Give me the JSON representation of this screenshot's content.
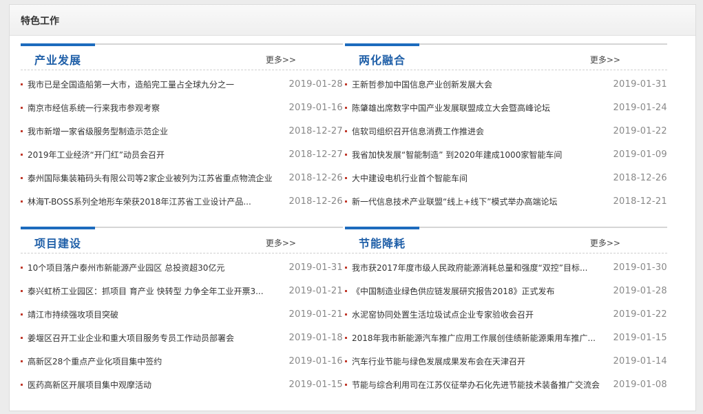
{
  "panel": {
    "title": "特色工作"
  },
  "sections": [
    {
      "title": "产业发展",
      "more": "更多>>",
      "items": [
        {
          "title": "我市已是全国造船第一大市，造船完工量占全球九分之一",
          "date": "2019-01-28"
        },
        {
          "title": "南京市经信系统一行来我市参观考察",
          "date": "2019-01-16"
        },
        {
          "title": "我市新增一家省级服务型制造示范企业",
          "date": "2018-12-27"
        },
        {
          "title": "2019年工业经济“开门红”动员会召开",
          "date": "2018-12-27"
        },
        {
          "title": "泰州国际集装箱码头有限公司等2家企业被列为江苏省重点物流企业",
          "date": "2018-12-26"
        },
        {
          "title": "林海T-BOSS系列全地形车荣获2018年江苏省工业设计产品...",
          "date": "2018-12-26"
        }
      ]
    },
    {
      "title": "两化融合",
      "more": "更多>>",
      "items": [
        {
          "title": "王新哲参加中国信息产业创新发展大会",
          "date": "2019-01-31"
        },
        {
          "title": "陈肇雄出席数字中国产业发展联盟成立大会暨高峰论坛",
          "date": "2019-01-24"
        },
        {
          "title": "信软司组织召开信息消费工作推进会",
          "date": "2019-01-22"
        },
        {
          "title": "我省加快发展“智能制造” 到2020年建成1000家智能车间",
          "date": "2019-01-09"
        },
        {
          "title": "大中建设电机行业首个智能车间",
          "date": "2018-12-26"
        },
        {
          "title": "新一代信息技术产业联盟“线上+线下”模式举办高端论坛",
          "date": "2018-12-21"
        }
      ]
    },
    {
      "title": "项目建设",
      "more": "更多>>",
      "items": [
        {
          "title": "10个项目落户泰州市新能源产业园区 总投资超30亿元",
          "date": "2019-01-31"
        },
        {
          "title": "泰兴虹桥工业园区：抓项目 育产业 快转型 力争全年工业开票3...",
          "date": "2019-01-21"
        },
        {
          "title": "靖江市持续强攻项目突破",
          "date": "2019-01-21"
        },
        {
          "title": "姜堰区召开工业企业和重大项目服务专员工作动员部署会",
          "date": "2019-01-18"
        },
        {
          "title": "高新区28个重点产业化项目集中签约",
          "date": "2019-01-16"
        },
        {
          "title": "医药高新区开展项目集中观摩活动",
          "date": "2019-01-15"
        }
      ]
    },
    {
      "title": "节能降耗",
      "more": "更多>>",
      "items": [
        {
          "title": "我市获2017年度市级人民政府能源消耗总量和强度“双控”目标...",
          "date": "2019-01-30"
        },
        {
          "title": "《中国制造业绿色供应链发展研究报告2018》正式发布",
          "date": "2019-01-28"
        },
        {
          "title": "水泥窑协同处置生活垃圾试点企业专家验收会召开",
          "date": "2019-01-22"
        },
        {
          "title": "2018年我市新能源汽车推广应用工作展创佳绩新能源乘用车推广...",
          "date": "2019-01-15"
        },
        {
          "title": "汽车行业节能与绿色发展成果发布会在天津召开",
          "date": "2019-01-14"
        },
        {
          "title": "节能与综合利用司在江苏仪征举办石化先进节能技术装备推广交流会",
          "date": "2019-01-08"
        }
      ]
    }
  ]
}
